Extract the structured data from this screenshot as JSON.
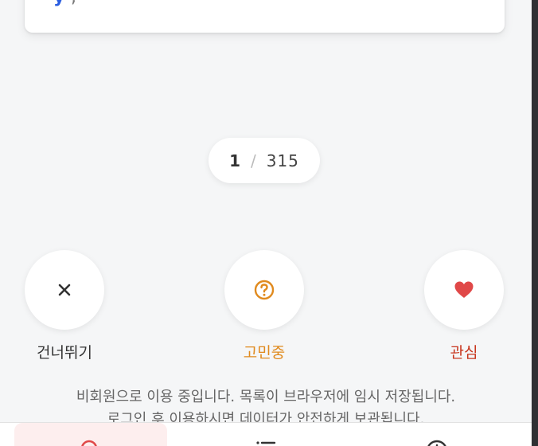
{
  "card": {
    "text": "y",
    "text_rest": ","
  },
  "counter": {
    "current": "1",
    "separator": "/",
    "total": "315"
  },
  "actions": [
    {
      "label": "건너뛰기",
      "icon": "close-icon",
      "color": "#333333"
    },
    {
      "label": "고민중",
      "icon": "question-circle-icon",
      "color": "#e08a1e"
    },
    {
      "label": "관심",
      "icon": "heart-icon",
      "color": "#e04848"
    }
  ],
  "notice": {
    "line1": "비회원으로 이용 중입니다. 목록이 브라우저에 임시 저장됩니다.",
    "line2": "로그인 후 이용하시면 데이터가 안전하게 보관됩니다."
  },
  "bottom_nav": {
    "items": [
      {
        "icon": "search-icon",
        "active": true
      },
      {
        "icon": "list-icon",
        "active": false
      },
      {
        "icon": "info-icon",
        "active": false
      }
    ]
  }
}
